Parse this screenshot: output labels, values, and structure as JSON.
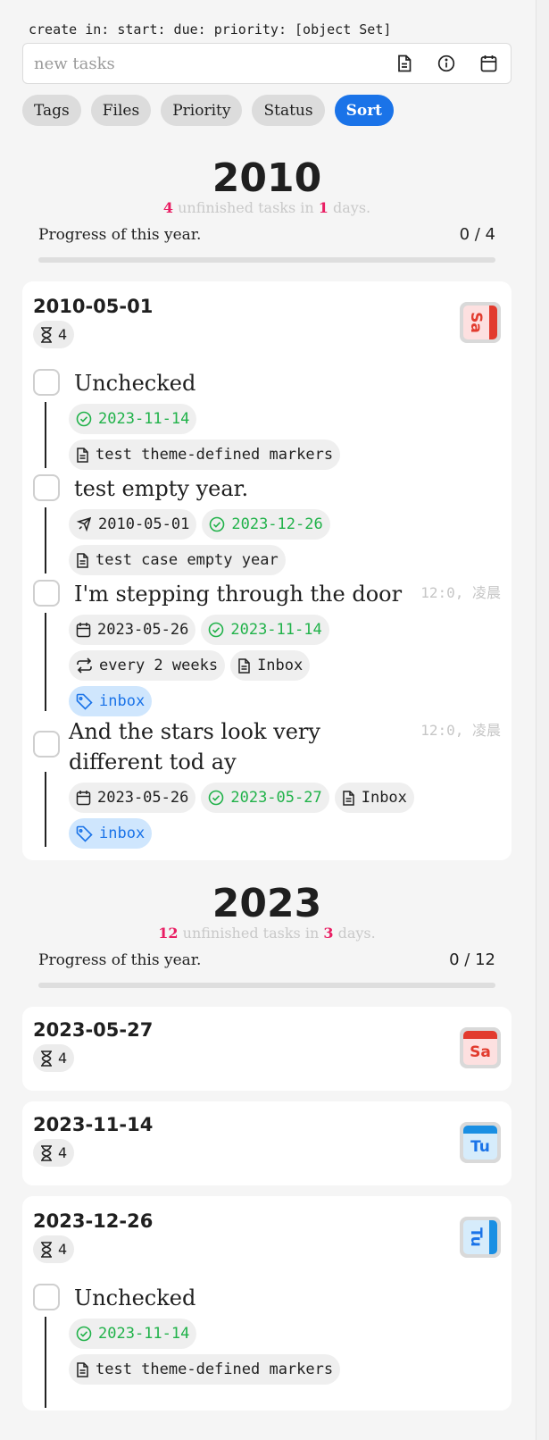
{
  "query_line": "create in: start: due: priority: [object Set]",
  "input": {
    "placeholder": "new tasks"
  },
  "filters": [
    "Tags",
    "Files",
    "Priority",
    "Status",
    "Sort"
  ],
  "active_filter": "Sort",
  "colors": {
    "accent": "#1a73e8",
    "highlight_num": "#e91e63",
    "done_green": "#21b24a"
  },
  "years": [
    {
      "year": "2010",
      "unfinished": "4",
      "days": "1",
      "text_mid": "unfinished tasks in",
      "text_end": "days.",
      "progress_label": "Progress of this year.",
      "progress_count": "0 / 4"
    },
    {
      "year": "2023",
      "unfinished": "12",
      "days": "3",
      "text_mid": "unfinished tasks in",
      "text_end": "days.",
      "progress_label": "Progress of this year.",
      "progress_count": "0 / 12"
    }
  ],
  "days": [
    {
      "date": "2010-05-01",
      "count": "4",
      "weekday": "Sa",
      "icon": "calendar-red-icon",
      "tasks": [
        {
          "text": "Unchecked",
          "done": "2023-11-14",
          "file": "test theme-defined markers"
        },
        {
          "text": "test empty year.",
          "start": "2010-05-01",
          "done": "2023-12-26",
          "file": "test case empty year"
        },
        {
          "text": "I'm stepping through the door",
          "time": "12:0, 凌晨",
          "scheduled": "2023-05-26",
          "done": "2023-11-14",
          "recur": "every 2 weeks",
          "file": "Inbox",
          "tag": "inbox"
        },
        {
          "text": "And the stars look very different tod ay",
          "time": "12:0, 凌晨",
          "scheduled": "2023-05-26",
          "done": "2023-05-27",
          "file": "Inbox",
          "tag": "inbox"
        }
      ]
    },
    {
      "date": "2023-05-27",
      "count": "4",
      "weekday": "Sa",
      "icon": "calendar-red-icon"
    },
    {
      "date": "2023-11-14",
      "count": "4",
      "weekday": "Tu",
      "icon": "calendar-blue-icon"
    },
    {
      "date": "2023-12-26",
      "count": "4",
      "weekday": "Tu",
      "icon": "calendar-blue-icon",
      "tasks": [
        {
          "text": "Unchecked",
          "done": "2023-11-14",
          "file": "test theme-defined markers"
        }
      ]
    }
  ]
}
